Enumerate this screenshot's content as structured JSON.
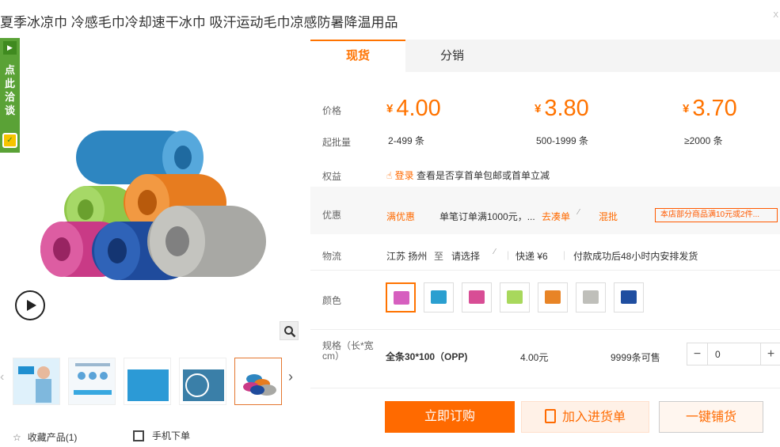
{
  "product": {
    "title": "夏季冰凉巾 冷感毛巾冷却速干冰巾 吸汗运动毛巾凉感防暑降温用品",
    "close_glyph": "X"
  },
  "chat": {
    "text": "点此洽谈"
  },
  "tabs": [
    {
      "label": "现货",
      "active": true
    },
    {
      "label": "分销",
      "active": false
    }
  ],
  "price": {
    "label": "价格",
    "currency": "¥",
    "tiers": [
      {
        "price": "4.00",
        "qty": "2-499 条"
      },
      {
        "price": "3.80",
        "qty": "500-1999 条"
      },
      {
        "price": "3.70",
        "qty": "≥2000 条"
      }
    ],
    "min_qty_label": "起批量"
  },
  "rights": {
    "label": "权益",
    "login": "登录",
    "text": "查看是否享首单包邮或首单立减"
  },
  "promo": {
    "label": "优惠",
    "full_discount": "满优惠",
    "full_desc": "单笔订单满1000元，...",
    "go_collect": "去凑单",
    "mix": "混批",
    "store_tag": "本店部分商品满10元或2件..."
  },
  "logistics": {
    "label": "物流",
    "from": "江苏 扬州",
    "to_word": "至",
    "select": "请选择",
    "express": "快递 ¥6",
    "ship_time": "付款成功后48小时内安排发货"
  },
  "color": {
    "label": "颜色",
    "swatches": [
      "#d65fbf",
      "#2a9fd0",
      "#d84d95",
      "#a8d85c",
      "#e88426",
      "#bfbfba",
      "#1f4ea0"
    ],
    "selected_index": 0
  },
  "spec": {
    "label": "规格（长*宽cm）",
    "name": "全条30*100（OPP)",
    "price": "4.00元",
    "stock": "9999条可售",
    "quantity": "0",
    "minus": "−",
    "plus": "+"
  },
  "actions": {
    "buy": "立即订购",
    "cart": "加入进货单",
    "shop": "一键铺货"
  },
  "footer": {
    "favorite": "收藏产品(1)",
    "mobile": "手机下单"
  }
}
